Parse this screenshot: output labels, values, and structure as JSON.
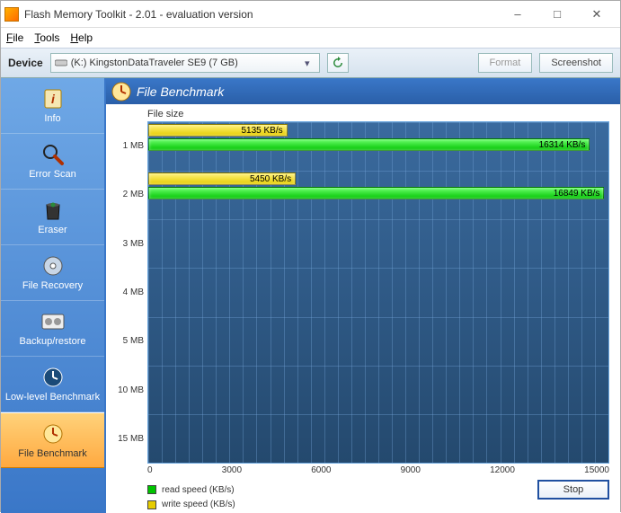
{
  "window": {
    "title": "Flash Memory Toolkit - 2.01 - evaluation version"
  },
  "menu": {
    "file": "File",
    "tools": "Tools",
    "help": "Help"
  },
  "toolbar": {
    "device_label": "Device",
    "device_value": "(K:) KingstonDataTraveler SE9 (7 GB)",
    "format_label": "Format",
    "screenshot_label": "Screenshot"
  },
  "sidebar": {
    "items": [
      {
        "label": "Info"
      },
      {
        "label": "Error Scan"
      },
      {
        "label": "Eraser"
      },
      {
        "label": "File Recovery"
      },
      {
        "label": "Backup/restore"
      },
      {
        "label": "Low-level Benchmark"
      },
      {
        "label": "File Benchmark"
      }
    ]
  },
  "panel": {
    "title": "File Benchmark"
  },
  "chart_data": {
    "type": "bar",
    "title": "File size",
    "ylabel": "File size",
    "xlabel": "",
    "x_ticks": [
      "0",
      "3000",
      "6000",
      "9000",
      "12000",
      "15000"
    ],
    "x_max": 17000,
    "categories": [
      "1 MB",
      "2 MB",
      "3 MB",
      "4 MB",
      "5 MB",
      "10 MB",
      "15 MB"
    ],
    "series": [
      {
        "name": "write speed (KB/s)",
        "values": [
          5135,
          5450,
          null,
          null,
          null,
          null,
          null
        ]
      },
      {
        "name": "read speed (KB/s)",
        "values": [
          16314,
          16849,
          null,
          null,
          null,
          null,
          null
        ]
      }
    ],
    "value_labels": {
      "write": [
        "5135 KB/s",
        "5450 KB/s"
      ],
      "read": [
        "16314 KB/s",
        "16849 KB/s"
      ]
    },
    "legend": {
      "read": "read speed (KB/s)",
      "write": "write speed (KB/s)"
    }
  },
  "buttons": {
    "stop": "Stop"
  }
}
